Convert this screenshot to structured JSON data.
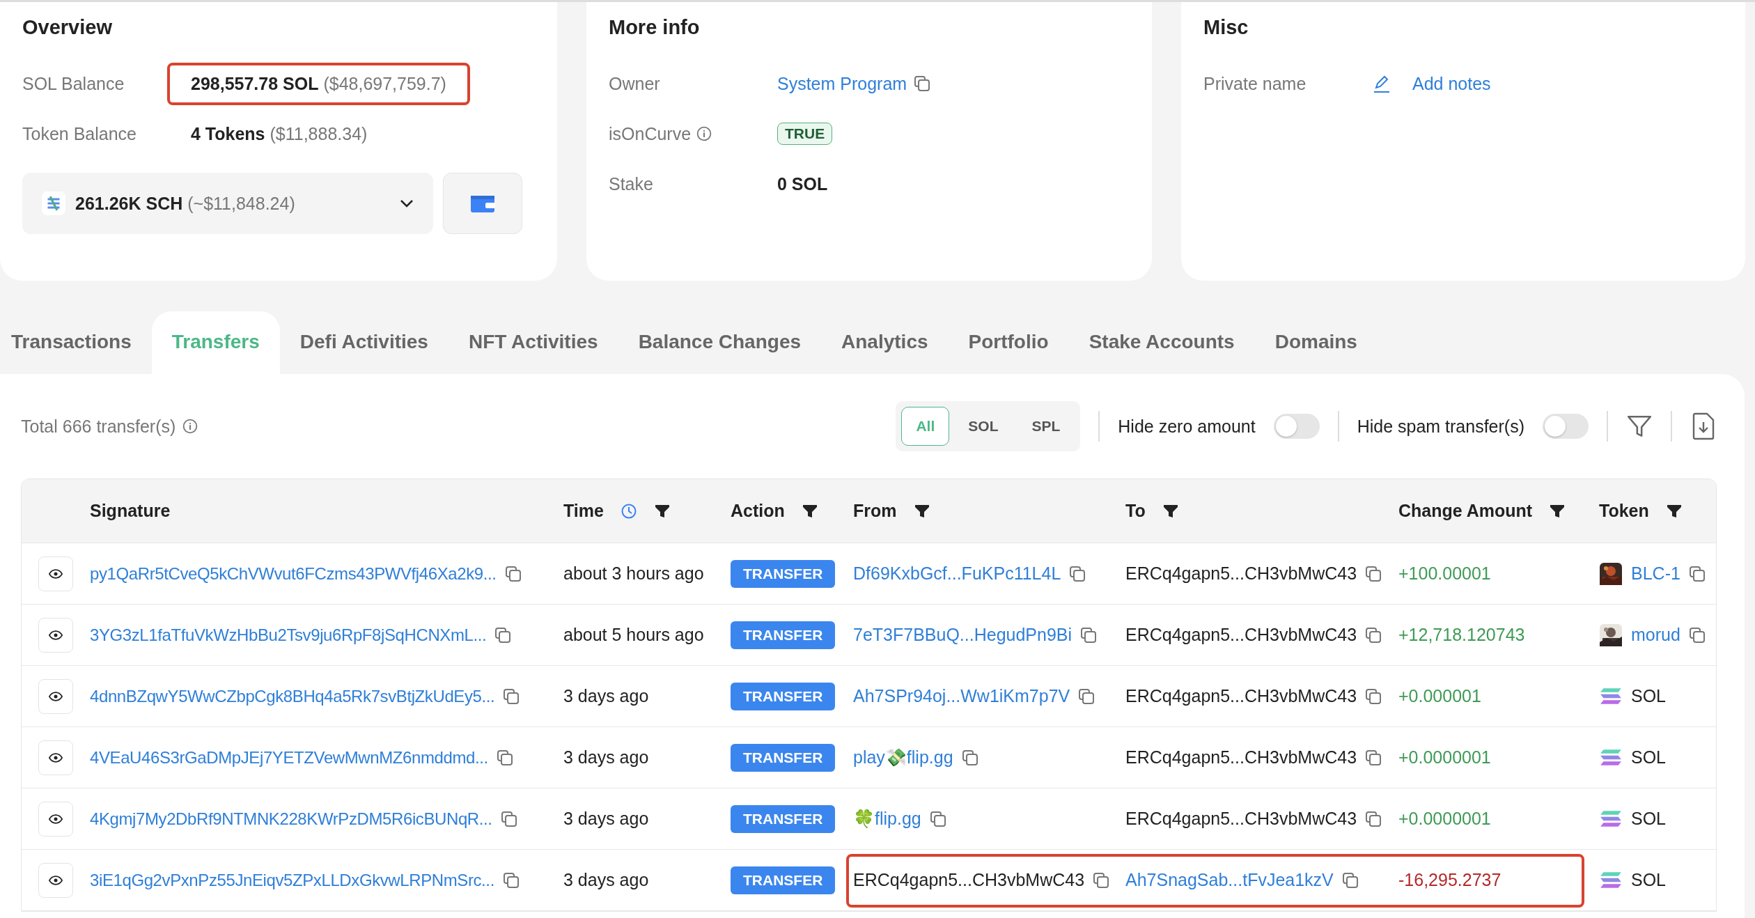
{
  "overview": {
    "title": "Overview",
    "rows": [
      {
        "label": "SOL Balance",
        "value": "298,557.78 SOL",
        "note": "($48,697,759.7)",
        "highlighted": true
      },
      {
        "label": "Token Balance",
        "value": "4 Tokens",
        "note": "($11,888.34)",
        "highlighted": false
      }
    ],
    "token_select": {
      "value": "261.26K SCH",
      "note": "(~$11,848.24)"
    }
  },
  "more_info": {
    "title": "More info",
    "rows": [
      {
        "label": "Owner",
        "kind": "link",
        "value": "System Program",
        "info": false
      },
      {
        "label": "isOnCurve",
        "kind": "badge",
        "value": "TRUE",
        "info": true
      },
      {
        "label": "Stake",
        "kind": "bold",
        "value": "0 SOL",
        "info": false
      }
    ]
  },
  "misc": {
    "title": "Misc",
    "rows": [
      {
        "label": "Private name",
        "action": "Add notes"
      }
    ]
  },
  "tabs": [
    {
      "label": "Transactions",
      "selected": false
    },
    {
      "label": "Transfers",
      "selected": true
    },
    {
      "label": "Defi Activities",
      "selected": false
    },
    {
      "label": "NFT Activities",
      "selected": false
    },
    {
      "label": "Balance Changes",
      "selected": false
    },
    {
      "label": "Analytics",
      "selected": false
    },
    {
      "label": "Portfolio",
      "selected": false
    },
    {
      "label": "Stake Accounts",
      "selected": false
    },
    {
      "label": "Domains",
      "selected": false
    }
  ],
  "summary": "Total 666 transfer(s)",
  "type_filter": [
    {
      "label": "All",
      "selected": true
    },
    {
      "label": "SOL",
      "selected": false
    },
    {
      "label": "SPL",
      "selected": false
    }
  ],
  "toggles": [
    {
      "label": "Hide zero amount",
      "on": false
    },
    {
      "label": "Hide spam transfer(s)",
      "on": false
    }
  ],
  "table": {
    "columns": [
      {
        "label": "Signature",
        "clock": false,
        "filter": false
      },
      {
        "label": "Time",
        "clock": true,
        "filter": true
      },
      {
        "label": "Action",
        "clock": false,
        "filter": true
      },
      {
        "label": "From",
        "clock": false,
        "filter": true
      },
      {
        "label": "To",
        "clock": false,
        "filter": true
      },
      {
        "label": "Change Amount",
        "clock": false,
        "filter": true
      },
      {
        "label": "Token",
        "clock": false,
        "filter": true
      }
    ],
    "rows": [
      {
        "signature": "py1QaRr5tCveQ5kChVWvut6FCzms43PWVfj46Xa2k9...",
        "time": "about 3 hours ago",
        "action": "TRANSFER",
        "from": {
          "text": "Df69KxbGcf...FuKPc11L4L",
          "linked": true
        },
        "to": {
          "text": "ERCq4gapn5...CH3vbMwC43",
          "linked": false
        },
        "amount": "+100.00001",
        "color": "#3e9a55",
        "token": {
          "symbol": "BLC-1",
          "linked": true,
          "kind": "picture"
        },
        "highlighted": false
      },
      {
        "signature": "3YG3zL1faTfuVkWzHbBu2Tsv9ju6RpF8jSqHCNXmL...",
        "time": "about 5 hours ago",
        "action": "TRANSFER",
        "from": {
          "text": "7eT3F7BBuQ...HegudPn9Bi",
          "linked": true
        },
        "to": {
          "text": "ERCq4gapn5...CH3vbMwC43",
          "linked": false
        },
        "amount": "+12,718.120743",
        "color": "#3e9a55",
        "token": {
          "symbol": "morud",
          "linked": true,
          "kind": "picture"
        },
        "highlighted": false
      },
      {
        "signature": "4dnnBZqwY5WwCZbpCgk8BHq4a5Rk7svBtjZkUdEy5...",
        "time": "3 days ago",
        "action": "TRANSFER",
        "from": {
          "text": "Ah7SPr94oj...Ww1iKm7p7V",
          "linked": true
        },
        "to": {
          "text": "ERCq4gapn5...CH3vbMwC43",
          "linked": false
        },
        "amount": "+0.000001",
        "color": "#3e9a55",
        "token": {
          "symbol": "SOL",
          "linked": false,
          "kind": "sol"
        },
        "highlighted": false
      },
      {
        "signature": "4VEaU46S3rGaDMpJEj7YETZVewMwnMZ6nmddmd...",
        "time": "3 days ago",
        "action": "TRANSFER",
        "from": {
          "text": "play💸flip.gg",
          "linked": true
        },
        "to": {
          "text": "ERCq4gapn5...CH3vbMwC43",
          "linked": false
        },
        "amount": "+0.0000001",
        "color": "#3e9a55",
        "token": {
          "symbol": "SOL",
          "linked": false,
          "kind": "sol"
        },
        "highlighted": false
      },
      {
        "signature": "4Kgmj7My2DbRf9NTMNK228KWrPzDM5R6icBUNqR...",
        "time": "3 days ago",
        "action": "TRANSFER",
        "from": {
          "text": "🍀flip.gg",
          "linked": true
        },
        "to": {
          "text": "ERCq4gapn5...CH3vbMwC43",
          "linked": false
        },
        "amount": "+0.0000001",
        "color": "#3e9a55",
        "token": {
          "symbol": "SOL",
          "linked": false,
          "kind": "sol"
        },
        "highlighted": false
      },
      {
        "signature": "3iE1qGg2vPxnPz55JnEiqv5ZPxLLDxGkvwLRPNmSrc...",
        "time": "3 days ago",
        "action": "TRANSFER",
        "from": {
          "text": "ERCq4gapn5...CH3vbMwC43",
          "linked": false
        },
        "to": {
          "text": "Ah7SnagSab...tFvJea1kzV",
          "linked": true
        },
        "amount": "-16,295.2737",
        "color": "#b5282a",
        "token": {
          "symbol": "SOL",
          "linked": false,
          "kind": "sol"
        },
        "highlighted": true
      }
    ]
  }
}
